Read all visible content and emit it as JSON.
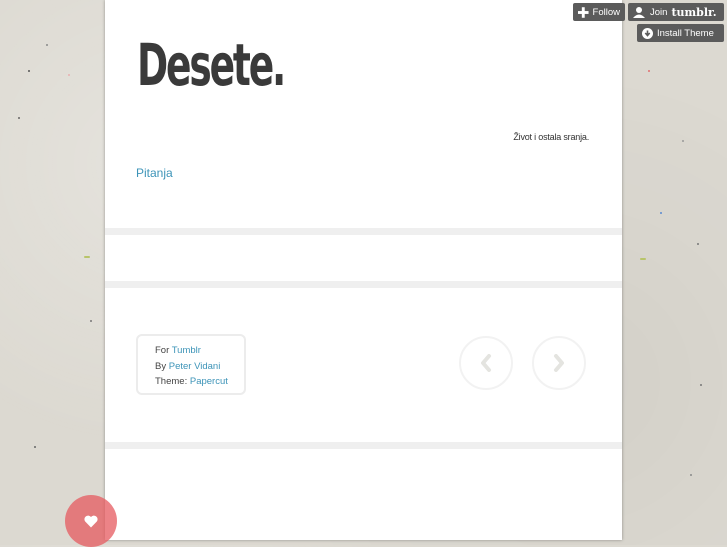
{
  "blog": {
    "title": "Desete.",
    "tagline": "Život i ostala sranja.",
    "nav_links": [
      {
        "label": "Pitanja"
      }
    ]
  },
  "credits": {
    "for_prefix": "For",
    "for_link": "Tumblr",
    "by_prefix": "By",
    "by_link": "Peter Vidani",
    "theme_prefix": "Theme:",
    "theme_link": "Papercut"
  },
  "pagination": {
    "prev_icon": "chevron-left-icon",
    "next_icon": "chevron-right-icon"
  },
  "tumblr_controls": {
    "follow_label": "Follow",
    "join_label": "Join",
    "join_brand": "tumblr.",
    "install_label": "Install Theme"
  },
  "like_button": {
    "icon": "heart-icon",
    "color": "#e65a5f"
  },
  "colors": {
    "link": "#3d94b8",
    "control_bg": "#5b5b5b",
    "background": "#dcd9d1"
  }
}
